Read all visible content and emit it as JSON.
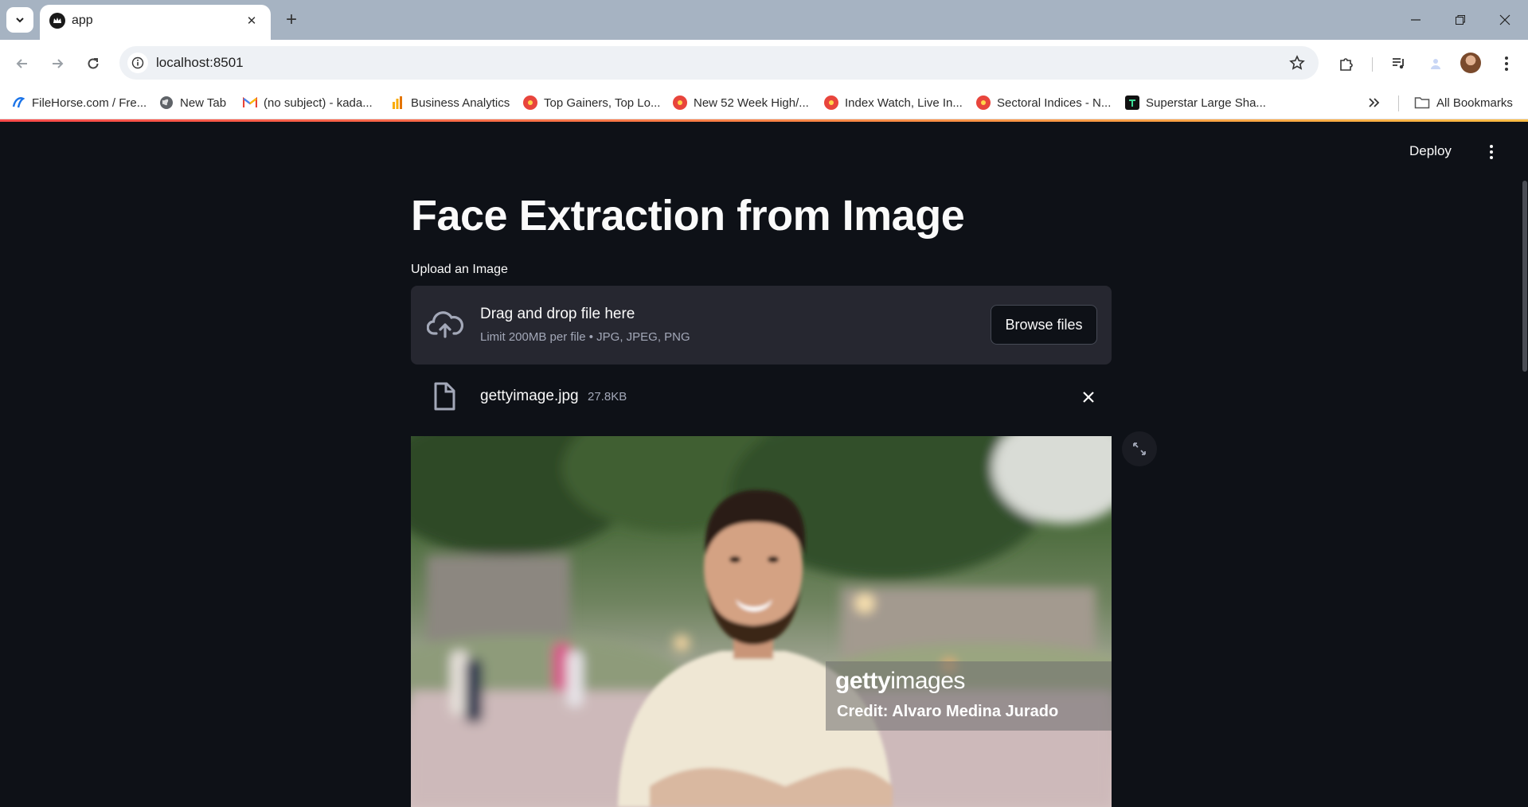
{
  "browser": {
    "tab": {
      "title": "app"
    },
    "url": "localhost:8501",
    "bookmarks": [
      {
        "label": "FileHorse.com / Fre...",
        "icon": "filehorse-icon",
        "color": "#1a73e8"
      },
      {
        "label": "New Tab",
        "icon": "globe-icon",
        "color": "#444444"
      },
      {
        "label": "(no subject) - kada...",
        "icon": "gmail-icon",
        "color": "#ea4335"
      },
      {
        "label": "Business Analytics",
        "icon": "analytics-icon",
        "color": "#f9ab00"
      },
      {
        "label": "Top Gainers, Top Lo...",
        "icon": "moneycontrol-icon",
        "color": "#e8453c"
      },
      {
        "label": "New 52 Week High/...",
        "icon": "moneycontrol-icon",
        "color": "#e8453c"
      },
      {
        "label": "Index Watch, Live In...",
        "icon": "moneycontrol-icon",
        "color": "#e8453c"
      },
      {
        "label": "Sectoral Indices - N...",
        "icon": "moneycontrol-icon",
        "color": "#e8453c"
      },
      {
        "label": "Superstar Large Sha...",
        "icon": "trendlyne-icon",
        "color": "#111111"
      }
    ],
    "all_bookmarks": "All Bookmarks"
  },
  "app": {
    "deploy_label": "Deploy",
    "title": "Face Extraction from Image",
    "uploader": {
      "label": "Upload an Image",
      "drop_text": "Drag and drop file here",
      "limit_text": "Limit 200MB per file • JPG, JPEG, PNG",
      "browse_label": "Browse files"
    },
    "file": {
      "name": "gettyimage.jpg",
      "size": "27.8KB"
    },
    "image": {
      "watermark_brand_bold": "getty",
      "watermark_brand_regular": "images",
      "credit": "Credit: Alvaro Medina Jurado"
    }
  },
  "colors": {
    "app_background": "#0e1117",
    "panel": "#262730",
    "text": "#fafafa",
    "muted_text": "#a3a8b8",
    "accent_gradient_start": "#ff4b4b",
    "accent_gradient_end": "#ffbd45"
  }
}
